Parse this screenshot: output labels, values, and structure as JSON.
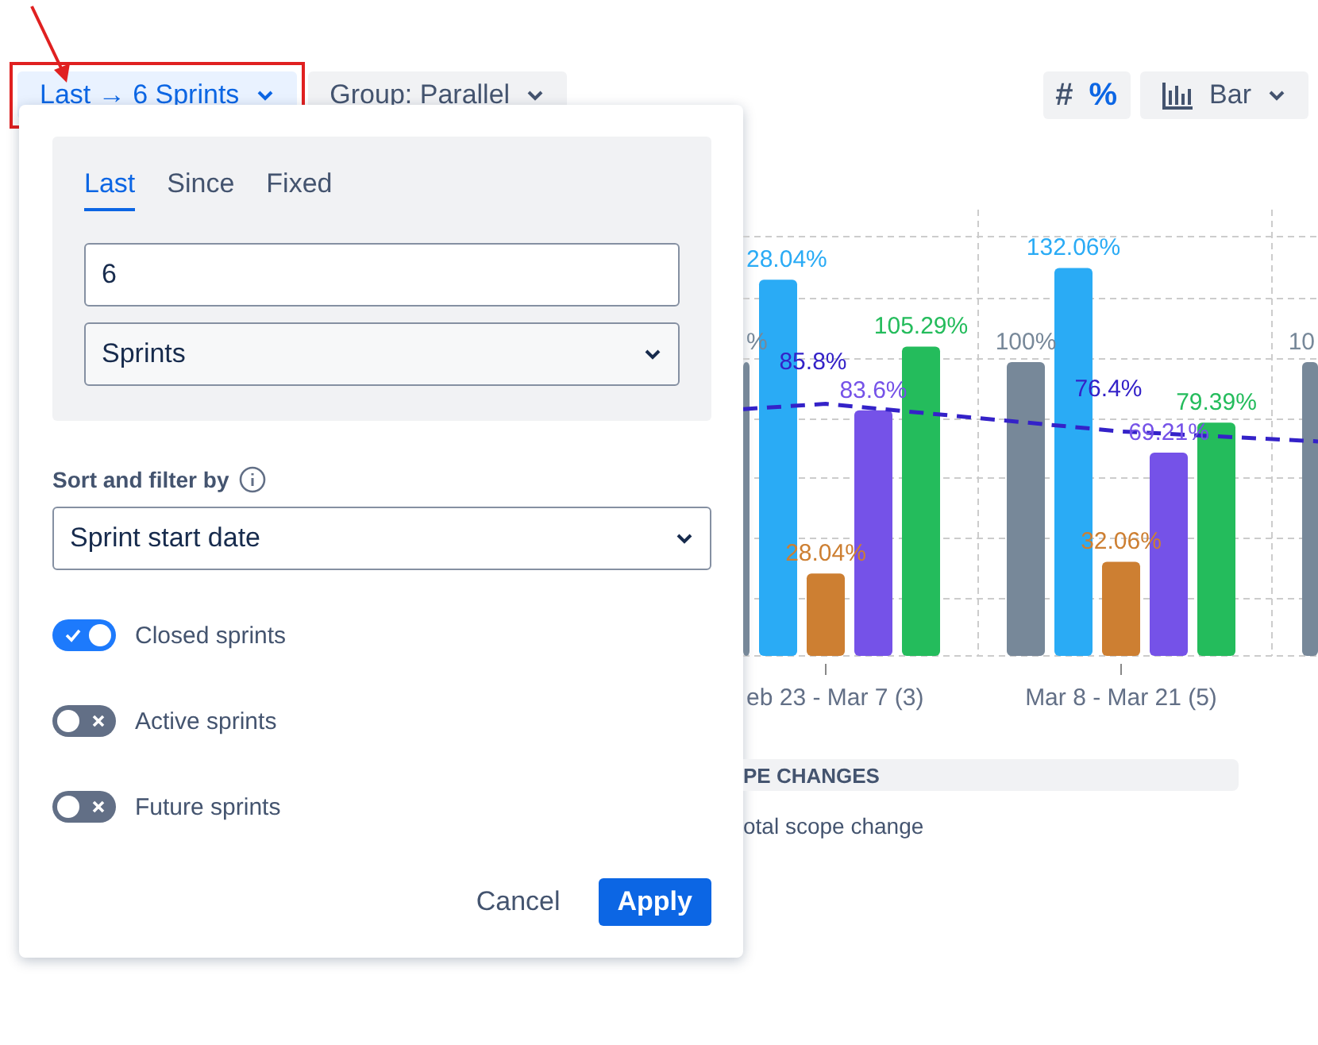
{
  "toolbar": {
    "range_button": {
      "label": "Last → 6 Sprints"
    },
    "group_button": {
      "label": "Group: Parallel"
    },
    "unit_toggle": [
      {
        "label": "#",
        "selected": false
      },
      {
        "label": "%",
        "selected": true
      }
    ],
    "chart_type_button": {
      "label": "Bar"
    }
  },
  "popover": {
    "tabs": [
      {
        "label": "Last",
        "selected": true
      },
      {
        "label": "Since",
        "selected": false
      },
      {
        "label": "Fixed",
        "selected": false
      }
    ],
    "count_field": {
      "value": "6"
    },
    "unit_select": {
      "value": "Sprints"
    },
    "sort_label": "Sort and filter by",
    "sort_select": {
      "value": "Sprint start date"
    },
    "toggles": [
      {
        "label": "Closed sprints",
        "on": true
      },
      {
        "label": "Active sprints",
        "on": false
      },
      {
        "label": "Future sprints",
        "on": false
      }
    ],
    "buttons": [
      {
        "label": "Cancel",
        "kind": "secondary"
      },
      {
        "label": "Apply",
        "kind": "primary"
      }
    ]
  },
  "chart": {
    "groups": [
      {
        "label": "eb 23 - Mar 7 (3)",
        "trend_label": "85.8%",
        "bar_labels": [
          {
            "kind": "blue",
            "text": "28.04%"
          },
          {
            "kind": "gray",
            "text": "%"
          },
          {
            "kind": "green",
            "text": "105.29%"
          },
          {
            "kind": "purple",
            "text": "83.6%"
          },
          {
            "kind": "orange",
            "text": "28.04%"
          }
        ]
      },
      {
        "label": "Mar 8 - Mar 21 (5)",
        "trend_label": "76.4%",
        "bar_labels": [
          {
            "kind": "blue",
            "text": "132.06%"
          },
          {
            "kind": "gray",
            "text": "100%"
          },
          {
            "kind": "green",
            "text": "79.39%"
          },
          {
            "kind": "purple",
            "text": "69.21%"
          },
          {
            "kind": "orange",
            "text": "32.06%"
          }
        ]
      },
      {
        "bar_labels": [
          {
            "kind": "gray",
            "text": "10"
          }
        ]
      }
    ]
  },
  "section": {
    "title": "PE CHANGES",
    "item": "otal scope change"
  }
}
